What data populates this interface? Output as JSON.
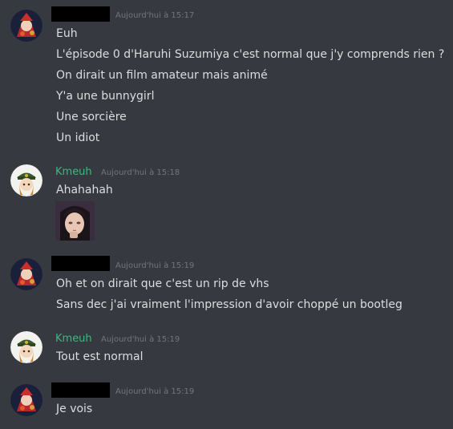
{
  "colors": {
    "background": "#36393f",
    "text": "#dcddde",
    "timestamp": "#72767d",
    "kmeuh_name": "#43b581",
    "redacted": "#000000"
  },
  "groups": [
    {
      "author": "",
      "redacted": true,
      "avatar_icon": "red-character-avatar-icon",
      "timestamp": "Aujourd'hui à 15:17",
      "messages": [
        "Euh",
        "L'épisode 0 d'Haruhi Suzumiya c'est normal que j'y comprends rien ?",
        "On dirait un film amateur mais animé",
        "Y'a une bunnygirl",
        "Une sorcière",
        "Un idiot"
      ]
    },
    {
      "author": "Kmeuh",
      "redacted": false,
      "avatar_icon": "soldier-character-avatar-icon",
      "timestamp": "Aujourd'hui à 15:18",
      "messages": [
        "Ahahahah"
      ],
      "attachment": "anime-girl-image-icon"
    },
    {
      "author": "",
      "redacted": true,
      "avatar_icon": "red-character-avatar-icon",
      "timestamp": "Aujourd'hui à 15:19",
      "messages": [
        "Oh et on dirait que c'est un rip de vhs",
        "Sans dec j'ai vraiment l'impression d'avoir choppé un bootleg"
      ]
    },
    {
      "author": "Kmeuh",
      "redacted": false,
      "avatar_icon": "soldier-character-avatar-icon",
      "timestamp": "Aujourd'hui à 15:19",
      "messages": [
        "Tout est normal"
      ]
    },
    {
      "author": "",
      "redacted": true,
      "avatar_icon": "red-character-avatar-icon",
      "timestamp": "Aujourd'hui à 15:19",
      "messages": [
        "Je vois"
      ]
    }
  ]
}
